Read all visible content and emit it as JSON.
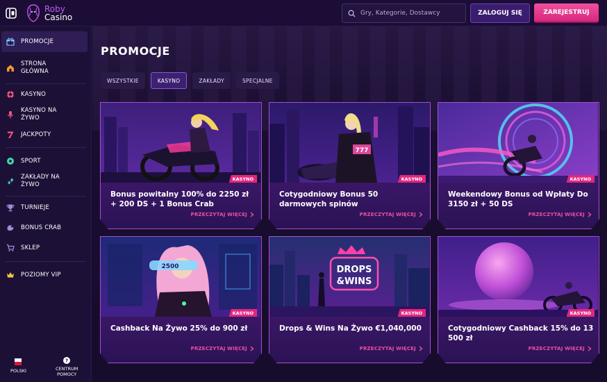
{
  "header": {
    "logo_line1": "Roby",
    "logo_line2": "Casino",
    "search_placeholder": "Gry, Kategorie, Dostawcy",
    "login_label": "ZALOGUJ SIĘ",
    "register_label": "ZAREJESTRUJ"
  },
  "sidebar": {
    "items": [
      {
        "label": "PROMOCJE",
        "icon": "gift-icon"
      },
      {
        "label": "STRONA GŁÓWNA",
        "icon": "home-icon"
      },
      {
        "label": "KASYNO",
        "icon": "casino-chip-icon"
      },
      {
        "label": "KASYNO NA ŻYWO",
        "icon": "microphone-icon"
      },
      {
        "label": "JACKPOTY",
        "icon": "seven-icon"
      },
      {
        "label": "SPORT",
        "icon": "soccer-ball-icon"
      },
      {
        "label": "ZAKŁADY NA ŻYWO",
        "icon": "lightning-ticket-icon"
      },
      {
        "label": "TURNIEJE",
        "icon": "trophy-icon"
      },
      {
        "label": "BONUS CRAB",
        "icon": "crab-claw-icon"
      },
      {
        "label": "SKLEP",
        "icon": "cart-icon"
      },
      {
        "label": "POZIOMY VIP",
        "icon": "crown-icon"
      }
    ],
    "bottom": {
      "language": "POLSKI",
      "help_line1": "CENTRUM",
      "help_line2": "POMOCY"
    }
  },
  "main": {
    "title": "PROMOCJE",
    "tabs": [
      "WSZYSTKIE",
      "KASYNO",
      "ZAKŁADY",
      "SPECJALNE"
    ],
    "active_tab": "KASYNO",
    "cards": [
      {
        "title": "Bonus powitalny 100% do 2250 zł + 200 DS + 1 Bonus Crab",
        "badge": "KASYNO",
        "link": "PRZECZYTAJ WIĘCEJ"
      },
      {
        "title": "Cotygodniowy Bonus 50 darmowych spinów",
        "badge": "KASYNO",
        "link": "PRZECZYTAJ WIĘCEJ"
      },
      {
        "title": "Weekendowy Bonus od Wpłaty Do 3150 zł + 50 DS",
        "badge": "KASYNO",
        "link": "PRZECZYTAJ WIĘCEJ"
      },
      {
        "title": "Cashback Na Żywo 25% do 900 zł",
        "badge": "KASYNO",
        "link": "PRZECZYTAJ WIĘCEJ"
      },
      {
        "title": "Drops & Wins Na Żywo €1,040,000",
        "badge": "KASYNO",
        "link": "PRZECZYTAJ WIĘCEJ",
        "image_text_1": "DROPS",
        "image_text_2": "&WINS"
      },
      {
        "title": "Cotygodniowy Cashback 15% do 13 500 zł",
        "badge": "KASYNO",
        "link": "PRZECZYTAJ WIĘCEJ"
      }
    ]
  },
  "colors": {
    "accent_pink": "#e1277f",
    "accent_purple": "#a74fd6",
    "link_pink": "#ee4fa2",
    "background": "#170c2c"
  }
}
